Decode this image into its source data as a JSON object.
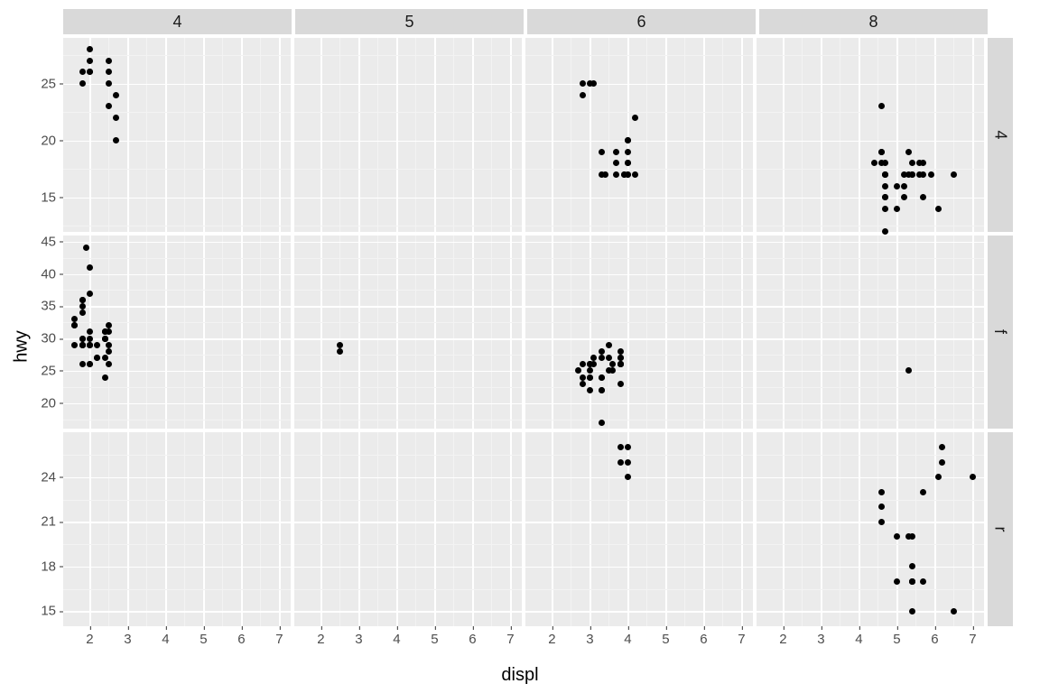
{
  "xlabel": "displ",
  "ylabel": "hwy",
  "grid": {
    "x_major": [
      2,
      3,
      4,
      5,
      6,
      7
    ],
    "x_minor": [
      2.5,
      3.5,
      4.5,
      5.5,
      6.5
    ]
  },
  "cols": [
    {
      "key": "cyl4",
      "label": "4"
    },
    {
      "key": "cyl5",
      "label": "5"
    },
    {
      "key": "cyl6",
      "label": "6"
    },
    {
      "key": "cyl8",
      "label": "8"
    }
  ],
  "rows": [
    {
      "key": "drv4",
      "label": "4",
      "ylim": [
        12,
        29
      ],
      "y_major": [
        15,
        20,
        25
      ],
      "y_minor": [
        12.5,
        17.5,
        22.5,
        27.5
      ]
    },
    {
      "key": "drvf",
      "label": "f",
      "ylim": [
        16,
        46
      ],
      "y_major": [
        20,
        25,
        30,
        35,
        40,
        45
      ],
      "y_minor": [
        17.5,
        22.5,
        27.5,
        32.5,
        37.5,
        42.5
      ]
    },
    {
      "key": "drvr",
      "label": "r",
      "ylim": [
        14,
        27
      ],
      "y_major": [
        15,
        18,
        21,
        24
      ],
      "y_minor": [
        16.5,
        19.5,
        22.5,
        25.5
      ]
    }
  ],
  "xlim": [
    1.3,
    7.3
  ],
  "x_ticks": [
    2,
    3,
    4,
    5,
    6,
    7
  ],
  "chart_data": {
    "type": "scatter",
    "facet_cols_var": "cyl",
    "facet_rows_var": "drv",
    "xlabel": "displ",
    "ylabel": "hwy",
    "xlim": [
      1.3,
      7.3
    ],
    "facets": {
      "drv4": {
        "cyl4": [
          [
            1.8,
            26
          ],
          [
            1.8,
            25
          ],
          [
            2.0,
            28
          ],
          [
            2.0,
            27
          ],
          [
            2.0,
            26
          ],
          [
            2.5,
            27
          ],
          [
            2.5,
            25
          ],
          [
            2.5,
            26
          ],
          [
            2.7,
            24
          ],
          [
            2.7,
            20
          ],
          [
            2.7,
            22
          ],
          [
            2.0,
            26
          ],
          [
            2.5,
            23
          ]
        ],
        "cyl5": [],
        "cyl6": [
          [
            2.8,
            24
          ],
          [
            2.8,
            25
          ],
          [
            3.1,
            25
          ],
          [
            3.3,
            17
          ],
          [
            3.3,
            19
          ],
          [
            3.4,
            17
          ],
          [
            3.7,
            19
          ],
          [
            3.9,
            17
          ],
          [
            3.9,
            17
          ],
          [
            4.0,
            17
          ],
          [
            4.0,
            20
          ],
          [
            4.0,
            20
          ],
          [
            4.0,
            18
          ],
          [
            4.0,
            17
          ],
          [
            4.0,
            19
          ],
          [
            4.0,
            18
          ],
          [
            4.2,
            17
          ],
          [
            4.2,
            22
          ],
          [
            3.7,
            17
          ],
          [
            3.7,
            18
          ],
          [
            3.0,
            25
          ]
        ],
        "cyl8": [
          [
            4.4,
            18
          ],
          [
            4.6,
            18
          ],
          [
            4.6,
            19
          ],
          [
            4.6,
            19
          ],
          [
            4.7,
            17
          ],
          [
            4.7,
            17
          ],
          [
            4.7,
            12
          ],
          [
            4.7,
            17
          ],
          [
            4.7,
            15
          ],
          [
            4.7,
            16
          ],
          [
            4.7,
            18
          ],
          [
            4.7,
            14
          ],
          [
            4.7,
            15
          ],
          [
            5.2,
            17
          ],
          [
            5.2,
            15
          ],
          [
            5.3,
            17
          ],
          [
            5.3,
            19
          ],
          [
            5.4,
            17
          ],
          [
            5.4,
            17
          ],
          [
            5.4,
            18
          ],
          [
            5.7,
            17
          ],
          [
            5.7,
            15
          ],
          [
            5.7,
            18
          ],
          [
            5.9,
            17
          ],
          [
            6.5,
            17
          ],
          [
            4.6,
            23
          ],
          [
            5.0,
            14
          ],
          [
            5.6,
            17
          ],
          [
            5.6,
            18
          ],
          [
            6.1,
            14
          ],
          [
            5.0,
            16
          ],
          [
            5.2,
            16
          ]
        ]
      },
      "drvf": {
        "cyl4": [
          [
            1.8,
            29
          ],
          [
            1.8,
            29
          ],
          [
            2.0,
            31
          ],
          [
            2.0,
            30
          ],
          [
            1.6,
            33
          ],
          [
            1.6,
            32
          ],
          [
            1.6,
            32
          ],
          [
            1.6,
            29
          ],
          [
            1.8,
            34
          ],
          [
            1.8,
            36
          ],
          [
            1.8,
            36
          ],
          [
            2.0,
            29
          ],
          [
            2.4,
            24
          ],
          [
            2.4,
            30
          ],
          [
            2.4,
            27
          ],
          [
            2.4,
            30
          ],
          [
            2.4,
            31
          ],
          [
            1.9,
            44
          ],
          [
            2.0,
            29
          ],
          [
            2.0,
            26
          ],
          [
            2.0,
            29
          ],
          [
            2.2,
            27
          ],
          [
            2.2,
            27
          ],
          [
            2.4,
            31
          ],
          [
            2.4,
            31
          ],
          [
            2.5,
            26
          ],
          [
            2.5,
            28
          ],
          [
            2.2,
            29
          ],
          [
            1.8,
            35
          ],
          [
            2.0,
            37
          ],
          [
            2.0,
            41
          ],
          [
            2.5,
            29
          ],
          [
            2.5,
            31
          ],
          [
            1.8,
            29
          ],
          [
            1.8,
            30
          ],
          [
            1.8,
            30
          ],
          [
            1.8,
            29
          ],
          [
            1.8,
            26
          ],
          [
            2.0,
            26
          ],
          [
            2.5,
            32
          ],
          [
            2.4,
            30
          ]
        ],
        "cyl5": [
          [
            2.5,
            28
          ],
          [
            2.5,
            29
          ]
        ],
        "cyl6": [
          [
            2.8,
            26
          ],
          [
            3.1,
            27
          ],
          [
            3.5,
            29
          ],
          [
            3.6,
            26
          ],
          [
            2.8,
            24
          ],
          [
            3.3,
            28
          ],
          [
            3.8,
            26
          ],
          [
            3.8,
            28
          ],
          [
            3.8,
            27
          ],
          [
            3.3,
            27
          ],
          [
            3.3,
            24
          ],
          [
            3.8,
            26
          ],
          [
            3.8,
            23
          ],
          [
            3.8,
            26
          ],
          [
            3.8,
            26
          ],
          [
            3.8,
            27
          ],
          [
            3.0,
            22
          ],
          [
            3.0,
            24
          ],
          [
            3.0,
            24
          ],
          [
            3.3,
            22
          ],
          [
            3.3,
            22
          ],
          [
            3.3,
            17
          ],
          [
            3.5,
            27
          ],
          [
            3.5,
            25
          ],
          [
            2.8,
            23
          ],
          [
            3.3,
            24
          ],
          [
            3.6,
            25
          ],
          [
            3.0,
            26
          ],
          [
            3.0,
            26
          ],
          [
            2.7,
            25
          ],
          [
            3.0,
            25
          ],
          [
            3.1,
            26
          ],
          [
            3.8,
            26
          ],
          [
            3.0,
            26
          ]
        ],
        "cyl8": [
          [
            5.3,
            25
          ]
        ]
      },
      "drvr": {
        "cyl4": [],
        "cyl5": [],
        "cyl6": [
          [
            3.8,
            26
          ],
          [
            3.8,
            25
          ],
          [
            4.0,
            26
          ],
          [
            4.0,
            25
          ],
          [
            4.0,
            24
          ]
        ],
        "cyl8": [
          [
            4.6,
            23
          ],
          [
            4.6,
            22
          ],
          [
            5.4,
            20
          ],
          [
            5.4,
            15
          ],
          [
            4.6,
            21
          ],
          [
            5.0,
            20
          ],
          [
            5.4,
            17
          ],
          [
            5.4,
            17
          ],
          [
            5.4,
            18
          ],
          [
            6.1,
            24
          ],
          [
            6.2,
            26
          ],
          [
            6.2,
            25
          ],
          [
            7.0,
            24
          ],
          [
            5.7,
            17
          ],
          [
            6.5,
            15
          ],
          [
            5.3,
            20
          ],
          [
            5.7,
            23
          ],
          [
            5.0,
            17
          ],
          [
            5.4,
            17
          ],
          [
            5.4,
            17
          ]
        ]
      }
    }
  }
}
